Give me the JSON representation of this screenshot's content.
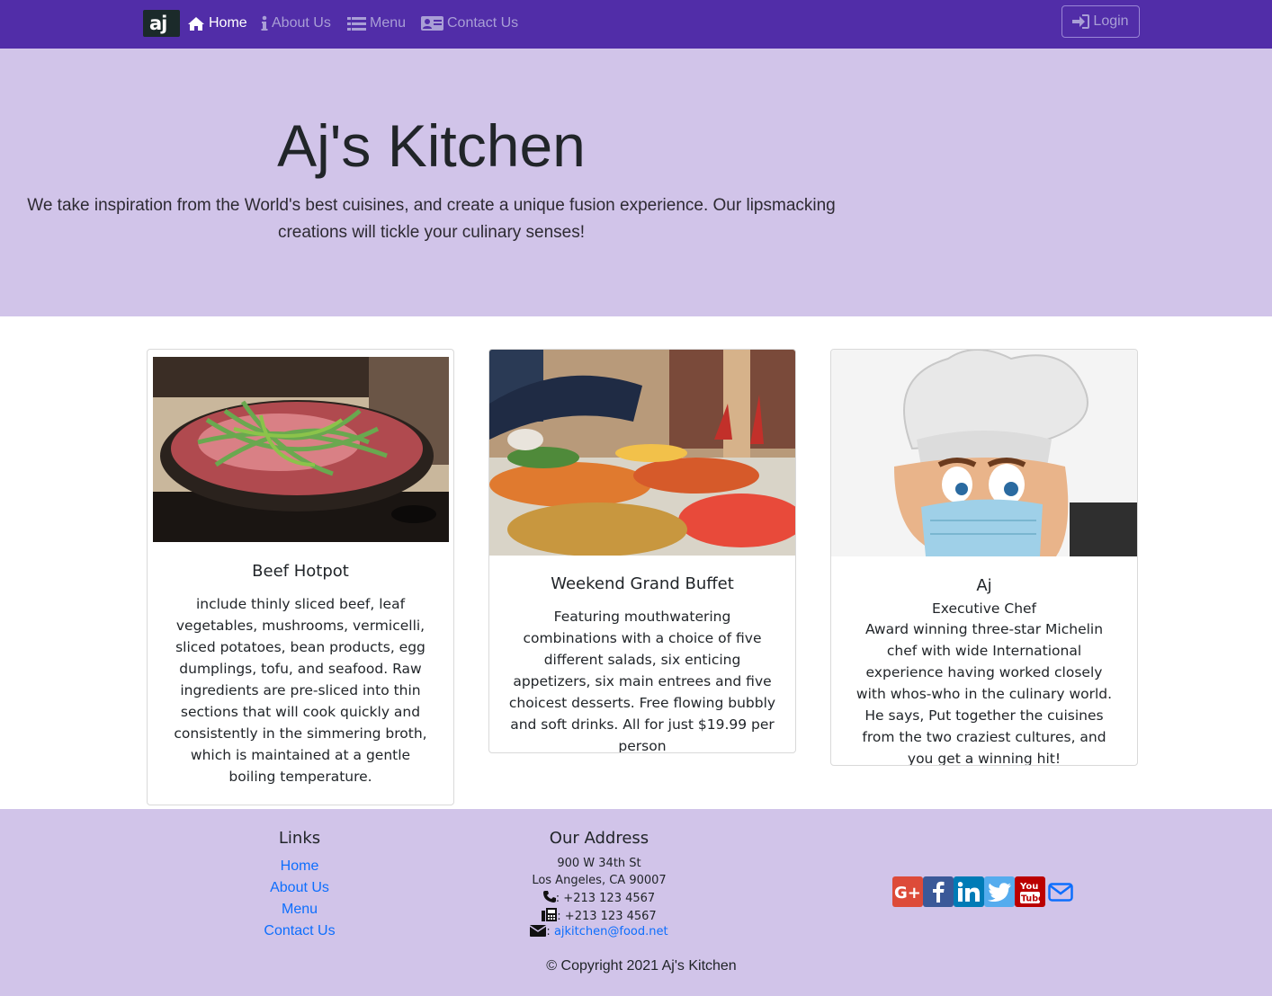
{
  "navbar": {
    "brand": "aj",
    "items": [
      {
        "label": "Home",
        "icon": "home-icon",
        "active": true
      },
      {
        "label": "About Us",
        "icon": "info-icon",
        "active": false
      },
      {
        "label": "Menu",
        "icon": "list-icon",
        "active": false
      },
      {
        "label": "Contact Us",
        "icon": "address-card-icon",
        "active": false
      }
    ],
    "login_label": "Login"
  },
  "hero": {
    "title": "Aj's Kitchen",
    "text": "We take inspiration from the World's best cuisines, and create a unique fusion experience. Our lipsmacking creations will tickle your culinary senses!"
  },
  "cards": [
    {
      "title": "Beef Hotpot",
      "text": "include thinly sliced beef, leaf vegetables, mushrooms, vermicelli, sliced potatoes, bean products, egg dumplings, tofu, and seafood. Raw ingredients are pre-sliced into thin sections that will cook quickly and consistently in the simmering broth, which is maintained at a gentle boiling temperature."
    },
    {
      "title": "Weekend Grand Buffet",
      "text": "Featuring mouthwatering combinations with a choice of five different salads, six enticing appetizers, six main entrees and five choicest desserts. Free flowing bubbly and soft drinks. All for just $19.99 per person"
    },
    {
      "title": "Aj",
      "subtitle": "Executive Chef",
      "text": "Award winning three-star Michelin chef with wide International experience having worked closely with whos-who in the culinary world. He says, Put together the cuisines from the two craziest cultures, and you get a winning hit!"
    }
  ],
  "footer": {
    "links_heading": "Links",
    "links": [
      "Home",
      "About Us",
      "Menu",
      "Contact Us"
    ],
    "address_heading": "Our Address",
    "address_line1": "900 W 34th St",
    "address_line2": "Los Angeles, CA 90007",
    "phone": ": +213 123 4567",
    "fax": ": +213 123 4567",
    "email_prefix": ":",
    "email": "ajkitchen@food.net",
    "copyright": "© Copyright 2021 Aj's Kitchen",
    "social": [
      {
        "name": "google-plus",
        "color": "#dd4b39"
      },
      {
        "name": "facebook",
        "color": "#3b5998"
      },
      {
        "name": "linkedin",
        "color": "#007bb6"
      },
      {
        "name": "twitter",
        "color": "#55acee"
      },
      {
        "name": "youtube",
        "color": "#bb0000"
      },
      {
        "name": "email",
        "color": "#0d6efd"
      }
    ]
  },
  "colors": {
    "navbar_bg": "#512da8",
    "hero_bg": "#d1c4e9",
    "link": "#0d6efd"
  }
}
